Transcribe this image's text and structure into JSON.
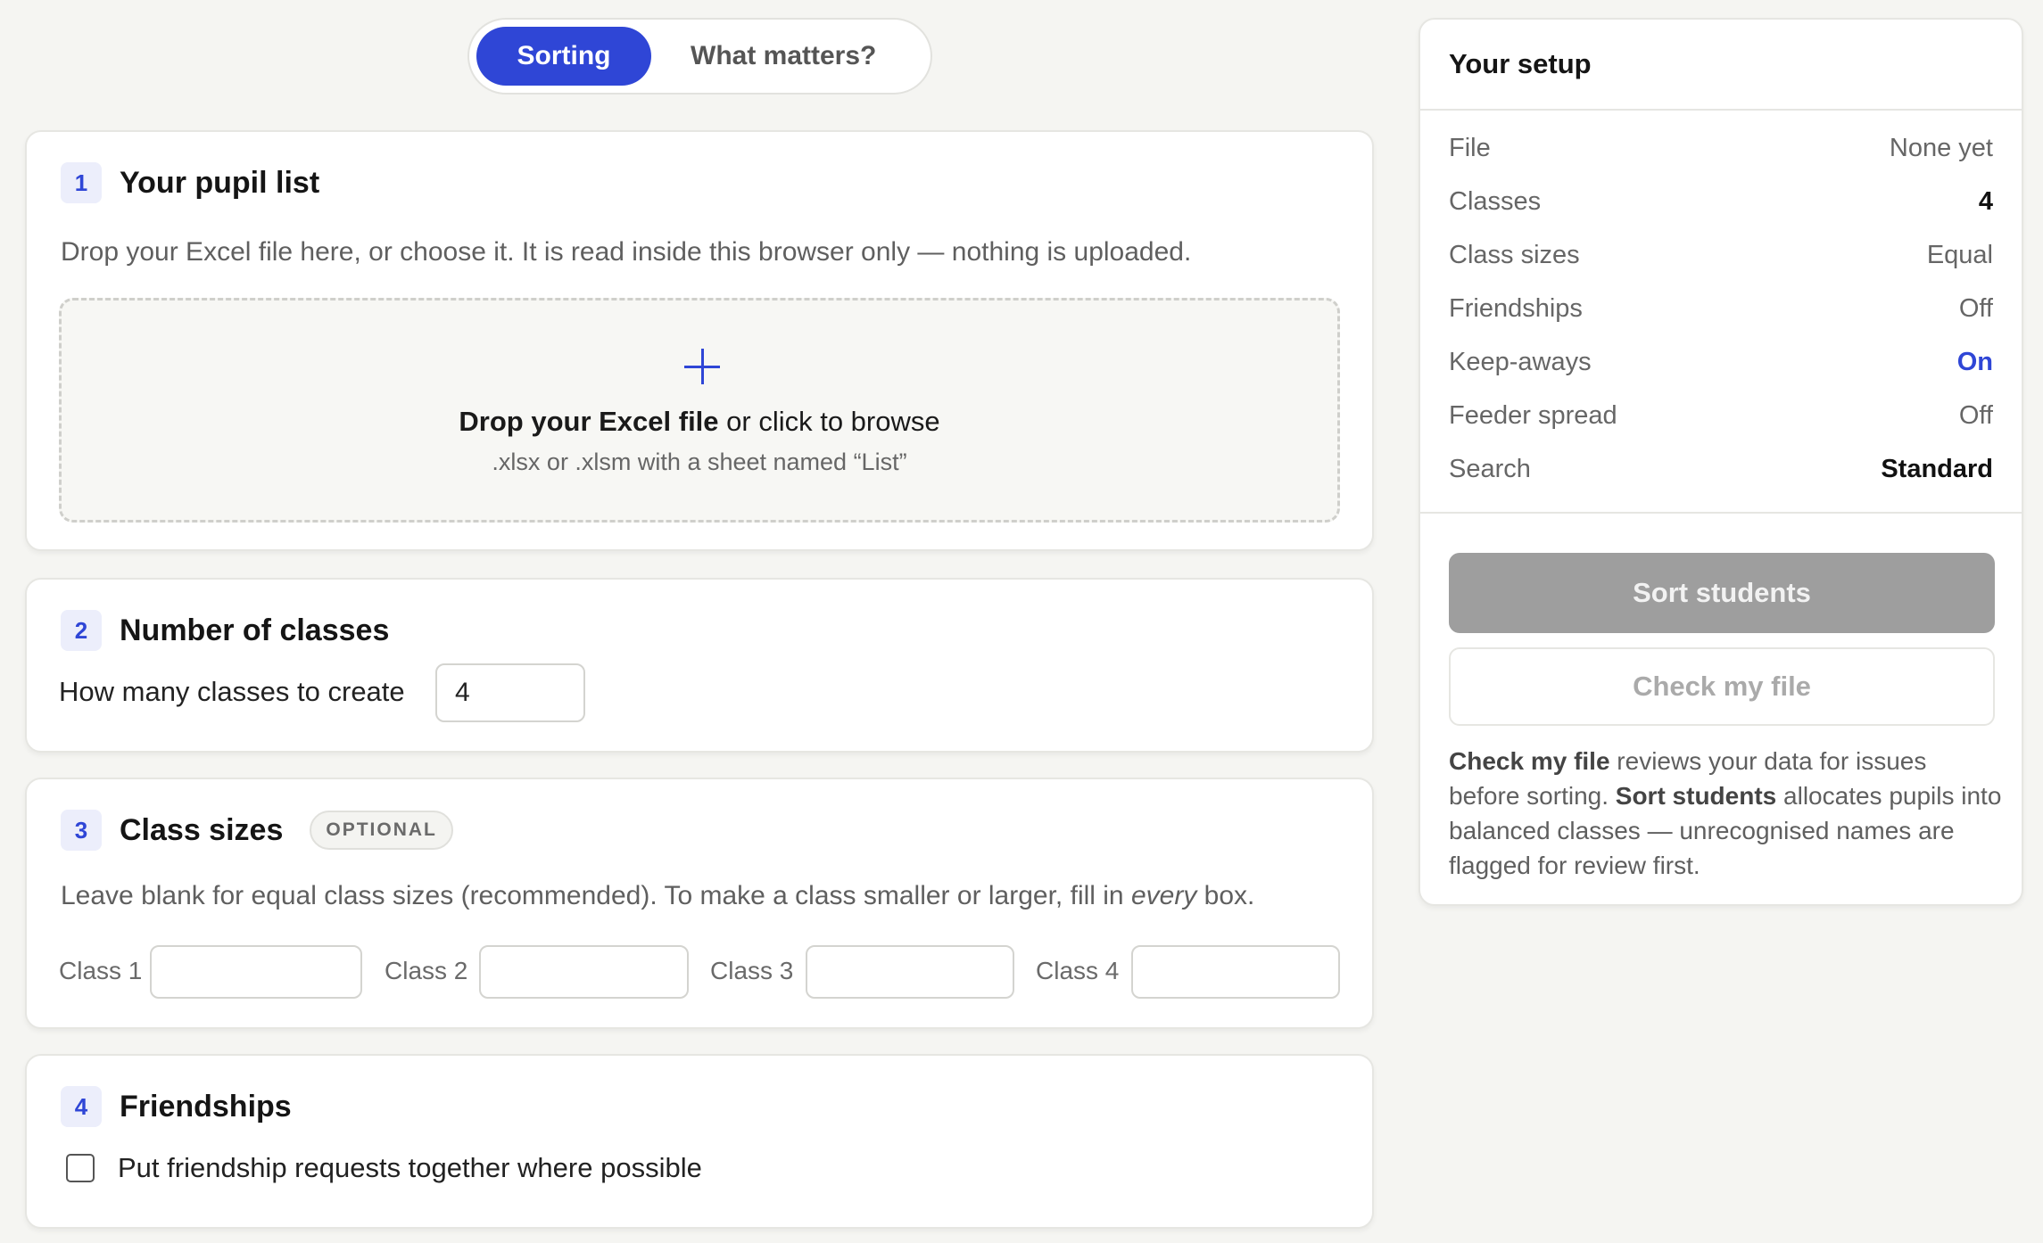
{
  "tabs": [
    {
      "label": "Sorting",
      "active": true
    },
    {
      "label": "What matters?",
      "active": false
    }
  ],
  "sections": {
    "pupil_list": {
      "number": "1",
      "title": "Your pupil list",
      "description": "Drop your Excel file here, or choose it. It is read inside this browser only — nothing is uploaded.",
      "drop_bold": "Drop your Excel file",
      "drop_rest": " or click to browse",
      "drop_hint": ".xlsx or .xlsm with a sheet named “List”"
    },
    "classes": {
      "number": "2",
      "title": "Number of classes",
      "label": "How many classes to create",
      "value": "4"
    },
    "class_sizes": {
      "number": "3",
      "title": "Class sizes",
      "badge": "OPTIONAL",
      "desc_before": "Leave blank for equal class sizes (recommended). To make a class smaller or larger, fill in ",
      "desc_em": "every",
      "desc_after": " box.",
      "inputs": [
        {
          "label": "Class 1",
          "value": ""
        },
        {
          "label": "Class 2",
          "value": ""
        },
        {
          "label": "Class 3",
          "value": ""
        },
        {
          "label": "Class 4",
          "value": ""
        }
      ]
    },
    "friendships": {
      "number": "4",
      "title": "Friendships",
      "checkbox_label": "Put friendship requests together where possible",
      "checked": false
    }
  },
  "setup": {
    "title": "Your setup",
    "rows": [
      {
        "key": "File",
        "value": "None yet"
      },
      {
        "key": "Classes",
        "value": "4"
      },
      {
        "key": "Class sizes",
        "value": "Equal"
      },
      {
        "key": "Friendships",
        "value": "Off"
      },
      {
        "key": "Keep-aways",
        "value": "On"
      },
      {
        "key": "Feeder spread",
        "value": "Off"
      },
      {
        "key": "Search",
        "value": "Standard"
      }
    ],
    "sort_button": "Sort students",
    "check_button": "Check my file",
    "help": {
      "b1": "Check my file",
      "t1": " reviews your data for issues before sorting. ",
      "b2": "Sort students",
      "t2": " allocates pupils into balanced classes — unrecognised names are flagged for review first."
    }
  },
  "colors": {
    "accent": "#2f46d6",
    "background": "#f5f5f2",
    "disabled_button": "#9e9e9e"
  }
}
